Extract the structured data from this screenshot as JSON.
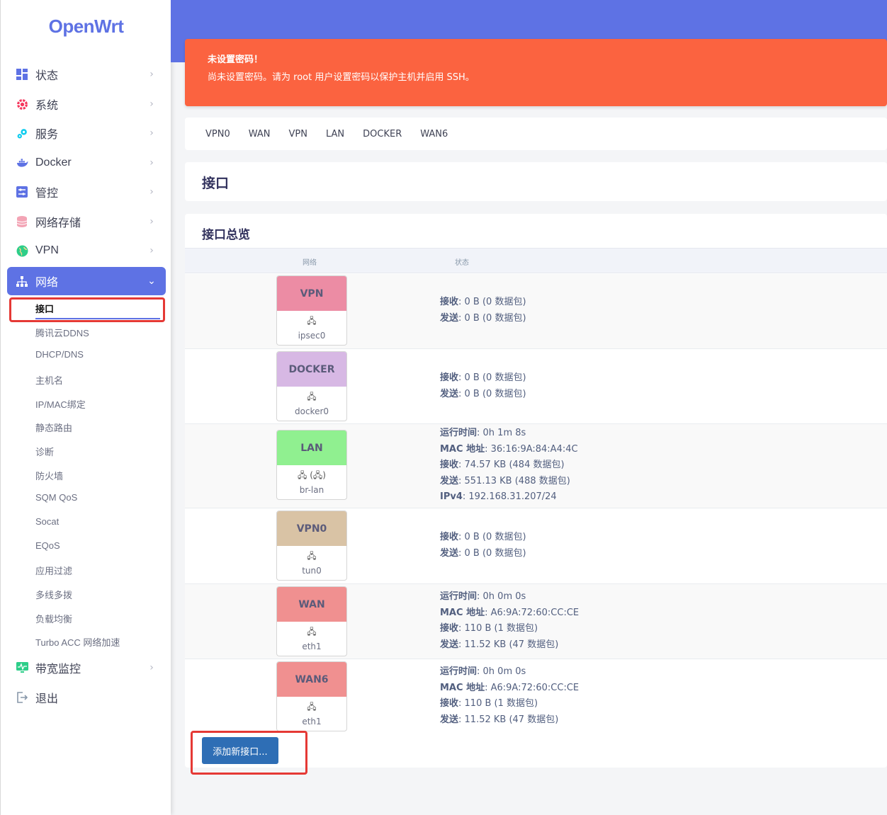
{
  "brand": {
    "logo": "OpenWrt"
  },
  "sidebar": {
    "menu": [
      {
        "label": "状态",
        "icon": "dashboard-icon",
        "color": "#5e72e4"
      },
      {
        "label": "系统",
        "icon": "gear-icon",
        "color": "#f5365c"
      },
      {
        "label": "服务",
        "icon": "cogs-icon",
        "color": "#11cdef"
      },
      {
        "label": "Docker",
        "icon": "docker-icon",
        "color": "#5e72e4"
      },
      {
        "label": "管控",
        "icon": "sliders-icon",
        "color": "#5e72e4"
      },
      {
        "label": "网络存储",
        "icon": "database-icon",
        "color": "#f3a4b5"
      },
      {
        "label": "VPN",
        "icon": "globe-icon",
        "color": "#2dce89"
      },
      {
        "label": "网络",
        "icon": "sitemap-icon",
        "color": "#ffffff"
      }
    ],
    "network_submenu": [
      "接口",
      "腾讯云DDNS",
      "DHCP/DNS",
      "主机名",
      "IP/MAC绑定",
      "静态路由",
      "诊断",
      "防火墙",
      "SQM QoS",
      "Socat",
      "EQoS",
      "应用过滤",
      "多线多拨",
      "负载均衡",
      "Turbo ACC 网络加速"
    ],
    "bottom_menu": [
      {
        "label": "带宽监控",
        "icon": "monitor-icon",
        "color": "#2dce89"
      },
      {
        "label": "退出",
        "icon": "logout-icon",
        "color": "#8898aa"
      }
    ]
  },
  "alert": {
    "title": "未设置密码！",
    "message": "尚未设置密码。请为 root 用户设置密码以保护主机并启用 SSH。",
    "color": "#fb6340"
  },
  "tabs": [
    "VPN0",
    "WAN",
    "VPN",
    "LAN",
    "DOCKER",
    "WAN6"
  ],
  "page_title": "接口",
  "overview": {
    "title": "接口总览",
    "col_network": "网络",
    "col_status": "状态",
    "interfaces": [
      {
        "name": "VPN",
        "color": "#ec8ca4",
        "device": "ipsec0",
        "icon_text": "🖧",
        "stats": [
          {
            "k": "接收",
            "v": "0 B (0 数据包)"
          },
          {
            "k": "发送",
            "v": "0 B (0 数据包)"
          }
        ]
      },
      {
        "name": "DOCKER",
        "color": "#d7b8e4",
        "device": "docker0",
        "icon_text": "🖧",
        "stats": [
          {
            "k": "接收",
            "v": "0 B (0 数据包)"
          },
          {
            "k": "发送",
            "v": "0 B (0 数据包)"
          }
        ]
      },
      {
        "name": "LAN",
        "color": "#90f090",
        "device": "br-lan",
        "icon_text": "🖧 (🖧)",
        "stats": [
          {
            "k": "运行时间",
            "v": "0h 1m 8s"
          },
          {
            "k": "MAC 地址",
            "v": "36:16:9A:84:A4:4C"
          },
          {
            "k": "接收",
            "v": "74.57 KB (484 数据包)"
          },
          {
            "k": "发送",
            "v": "551.13 KB (488 数据包)"
          },
          {
            "k": "IPv4",
            "v": "192.168.31.207/24"
          }
        ]
      },
      {
        "name": "VPN0",
        "color": "#d9c3a5",
        "device": "tun0",
        "icon_text": "🖧",
        "stats": [
          {
            "k": "接收",
            "v": "0 B (0 数据包)"
          },
          {
            "k": "发送",
            "v": "0 B (0 数据包)"
          }
        ]
      },
      {
        "name": "WAN",
        "color": "#f09090",
        "device": "eth1",
        "icon_text": "🖧",
        "stats": [
          {
            "k": "运行时间",
            "v": "0h 0m 0s"
          },
          {
            "k": "MAC 地址",
            "v": "A6:9A:72:60:CC:CE"
          },
          {
            "k": "接收",
            "v": "110 B (1 数据包)"
          },
          {
            "k": "发送",
            "v": "11.52 KB (47 数据包)"
          }
        ]
      },
      {
        "name": "WAN6",
        "color": "#f09090",
        "device": "eth1",
        "icon_text": "🖧",
        "stats": [
          {
            "k": "运行时间",
            "v": "0h 0m 0s"
          },
          {
            "k": "MAC 地址",
            "v": "A6:9A:72:60:CC:CE"
          },
          {
            "k": "接收",
            "v": "110 B (1 数据包)"
          },
          {
            "k": "发送",
            "v": "11.52 KB (47 数据包)"
          }
        ]
      }
    ],
    "add_button": "添加新接口..."
  }
}
